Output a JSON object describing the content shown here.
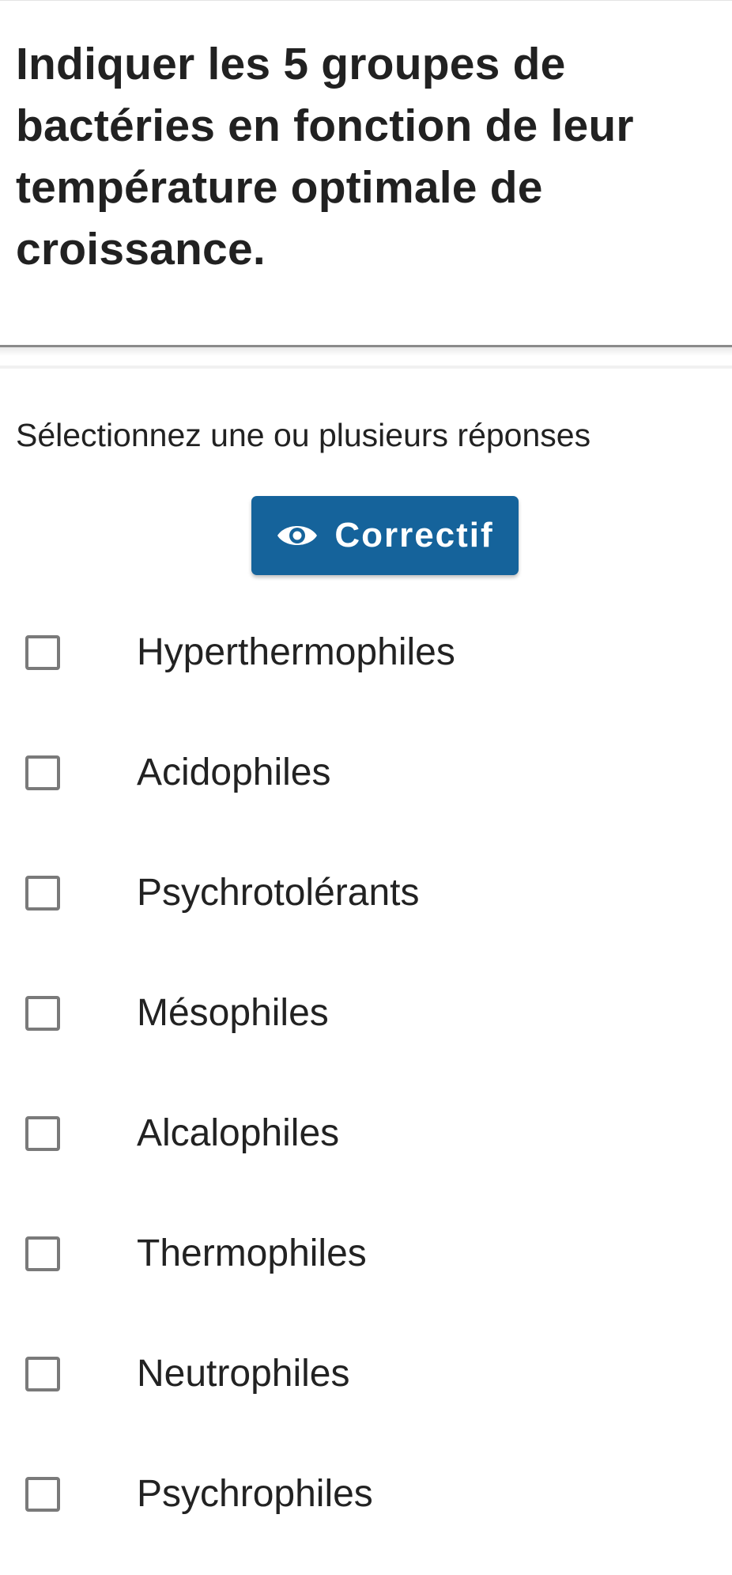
{
  "question": {
    "text": "Indiquer les 5 groupes de bactéries en fonction de leur température optimale de croissance."
  },
  "instruction": {
    "text": "Sélectionnez une ou plusieurs réponses"
  },
  "correctif_button": {
    "label": "Correctif",
    "icon": "eye-icon",
    "color": "#15639b"
  },
  "options": [
    {
      "label": "Hyperthermophiles",
      "checked": false
    },
    {
      "label": "Acidophiles",
      "checked": false
    },
    {
      "label": "Psychrotolérants",
      "checked": false
    },
    {
      "label": "Mésophiles",
      "checked": false
    },
    {
      "label": "Alcalophiles",
      "checked": false
    },
    {
      "label": "Thermophiles",
      "checked": false
    },
    {
      "label": "Neutrophiles",
      "checked": false
    },
    {
      "label": "Psychrophiles",
      "checked": false
    }
  ]
}
